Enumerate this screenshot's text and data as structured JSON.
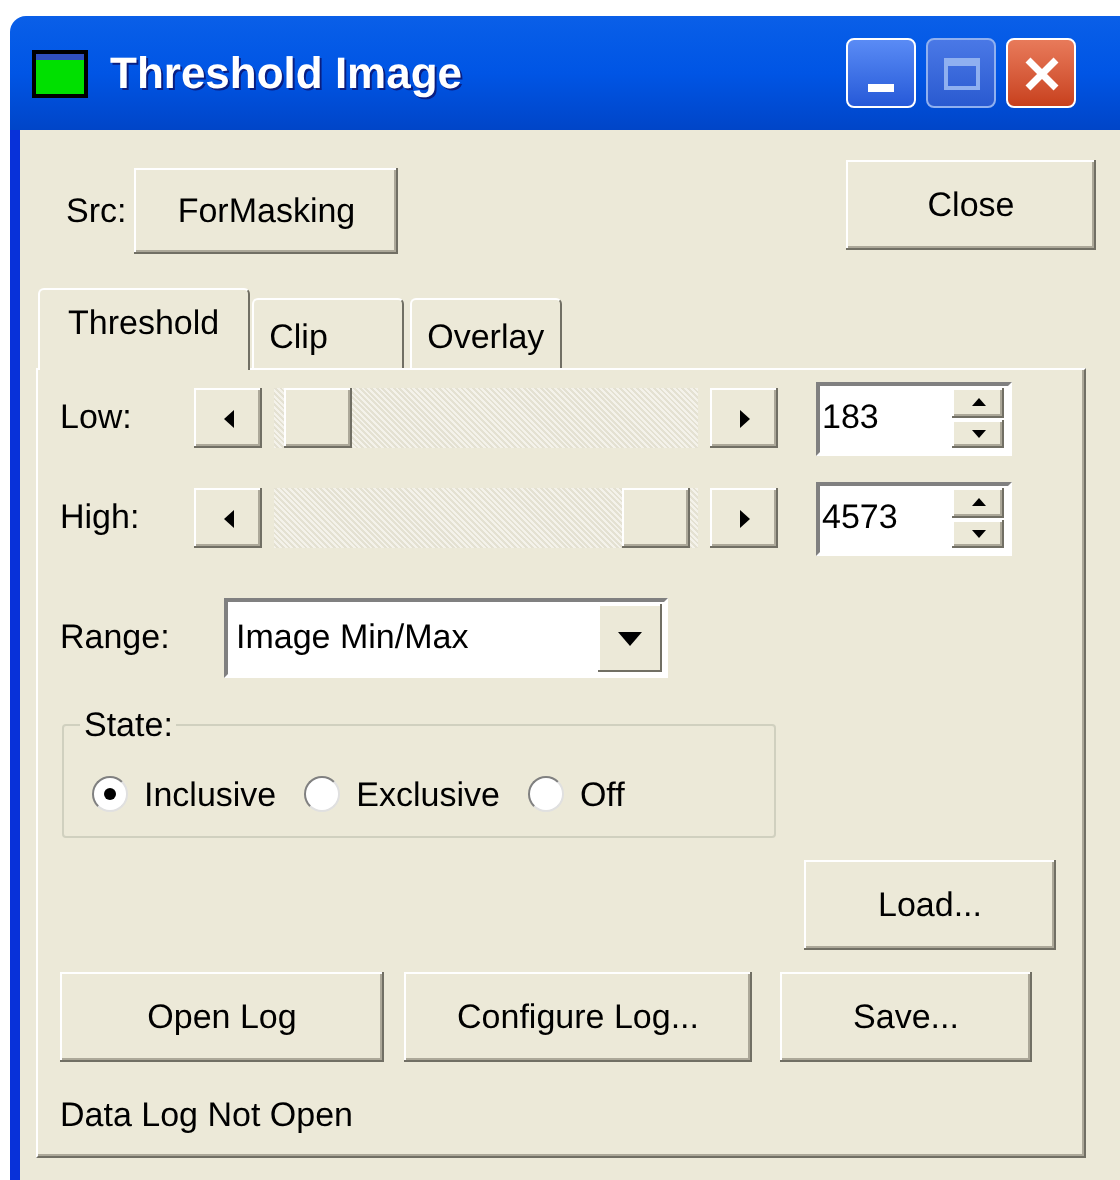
{
  "window": {
    "title": "Threshold Image"
  },
  "source": {
    "label": "Src:",
    "button": "ForMasking"
  },
  "close_button": "Close",
  "tabs": [
    {
      "label": "Threshold",
      "selected": true
    },
    {
      "label": "Clip",
      "selected": false
    },
    {
      "label": "Overlay",
      "selected": false
    }
  ],
  "sliders": [
    {
      "label": "Low:",
      "value": "183"
    },
    {
      "label": "High:",
      "value": "4573"
    }
  ],
  "range": {
    "label": "Range:",
    "value": "Image Min/Max"
  },
  "state": {
    "title": "State:",
    "options": [
      {
        "label": "Inclusive",
        "selected": true
      },
      {
        "label": "Exclusive",
        "selected": false
      },
      {
        "label": "Off",
        "selected": false
      }
    ]
  },
  "buttons": {
    "load": "Load...",
    "open_log": "Open Log",
    "configure_log": "Configure Log...",
    "save": "Save..."
  },
  "status": "Data Log Not Open"
}
